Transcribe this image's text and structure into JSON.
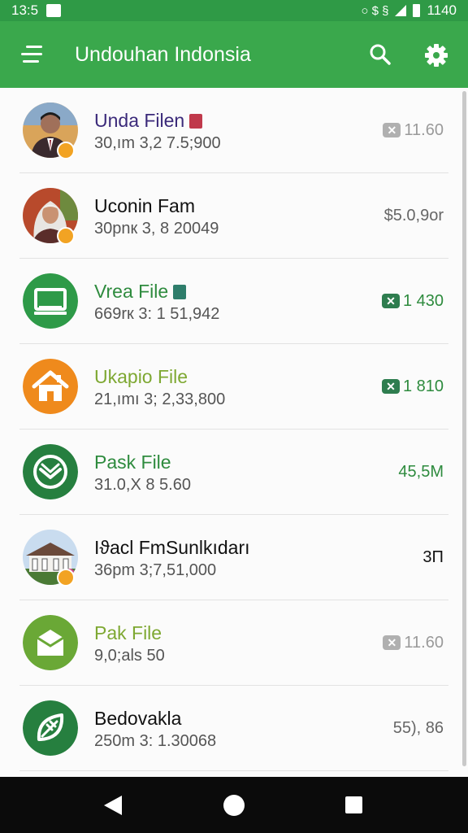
{
  "status_bar": {
    "time": "13:5",
    "glyphs": "○ $ §",
    "clock": "1140"
  },
  "app_bar": {
    "title": "Undouhan Indonsia",
    "menu_icon": "menu-icon",
    "search_icon": "search-icon",
    "settings_icon": "gear-icon"
  },
  "colors": {
    "primary": "#3aa84c",
    "primary_dark": "#2f9a46",
    "orange": "#ef8a1c",
    "olive": "#7ea832",
    "purple": "#3b2a7a"
  },
  "files": [
    {
      "title": "Unda Filen",
      "subtitle": "30,ım 3,2 7.5;900",
      "size": "11.60",
      "has_x_badge": true,
      "x_badge_color": "#b0b0b0",
      "icon": "person-photo",
      "title_color": "#3b2a7a",
      "size_color": "#9a9a9a",
      "tag_color": "#c0394b"
    },
    {
      "title": "Uconin Fam",
      "subtitle": "30pnк 3, 8 20049",
      "size": "$5.0,9οr",
      "has_x_badge": false,
      "icon": "person-hijab-photo",
      "title_color": "#111111",
      "size_color": "#666666"
    },
    {
      "title": "Vrea File",
      "subtitle": "669rк 3: 1 51,942",
      "size": "1 430",
      "has_x_badge": true,
      "x_badge_color": "#2e7d4f",
      "icon": "monitor-icon",
      "title_color": "#2e8b3e",
      "size_color": "#2e8b3e",
      "tag_color": "#2e7d6b"
    },
    {
      "title": "Ukapio File",
      "subtitle": "21,ımı 3; 2,33,800",
      "size": "1 810",
      "has_x_badge": true,
      "x_badge_color": "#2e7d4f",
      "icon": "house-icon",
      "title_color": "#7ea832",
      "size_color": "#2e8b3e"
    },
    {
      "title": "Pask File",
      "subtitle": "31.0,X 8 5.60",
      "size": "45,5M",
      "has_x_badge": false,
      "icon": "shield-check-icon",
      "title_color": "#2e8b3e",
      "size_color": "#2e8b3e"
    },
    {
      "title": "Iϑacl FmSunlkıdarı",
      "subtitle": "36pm 3;7,51,000",
      "size": "3Π",
      "has_x_badge": false,
      "icon": "building-photo",
      "title_color": "#111111",
      "size_color": "#111111"
    },
    {
      "title": "Pak File",
      "subtitle": "9,0;als 50",
      "size": "11.60",
      "has_x_badge": true,
      "x_badge_color": "#b0b0b0",
      "icon": "folder-icon",
      "title_color": "#7ea832",
      "size_color": "#9a9a9a"
    },
    {
      "title": "Bedovakla",
      "subtitle": "250m 3: 1.30068",
      "size": "55), 86",
      "has_x_badge": false,
      "icon": "leaf-icon",
      "title_color": "#111111",
      "size_color": "#666666"
    }
  ],
  "nav_bar": {
    "back_icon": "back-icon",
    "home_icon": "home-icon",
    "recents_icon": "recents-icon"
  }
}
